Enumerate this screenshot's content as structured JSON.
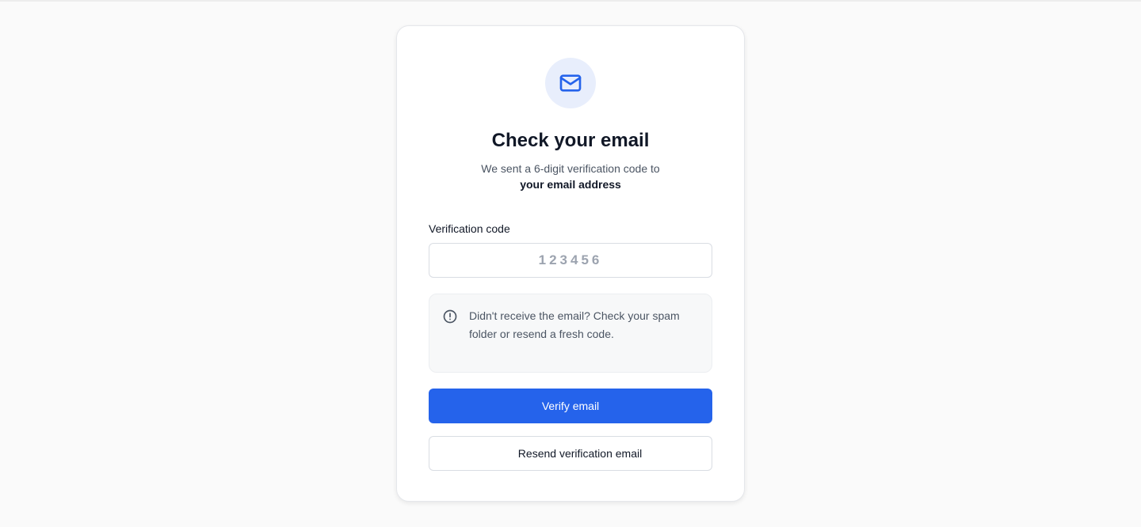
{
  "card": {
    "title": "Check your email",
    "subtitle": "We sent a 6-digit verification code to",
    "subtitle_emphasis": "your email address",
    "icon": "mail-icon"
  },
  "form": {
    "code_label": "Verification code",
    "code_placeholder": "123456",
    "code_value": ""
  },
  "notice": {
    "icon": "alert-circle-icon",
    "text": "Didn't receive the email? Check your spam folder or resend a fresh code."
  },
  "actions": {
    "verify_label": "Verify email",
    "resend_label": "Resend verification email"
  },
  "colors": {
    "accent": "#2563eb",
    "icon_bg": "#e8eefc",
    "page_bg": "#fafafa"
  }
}
